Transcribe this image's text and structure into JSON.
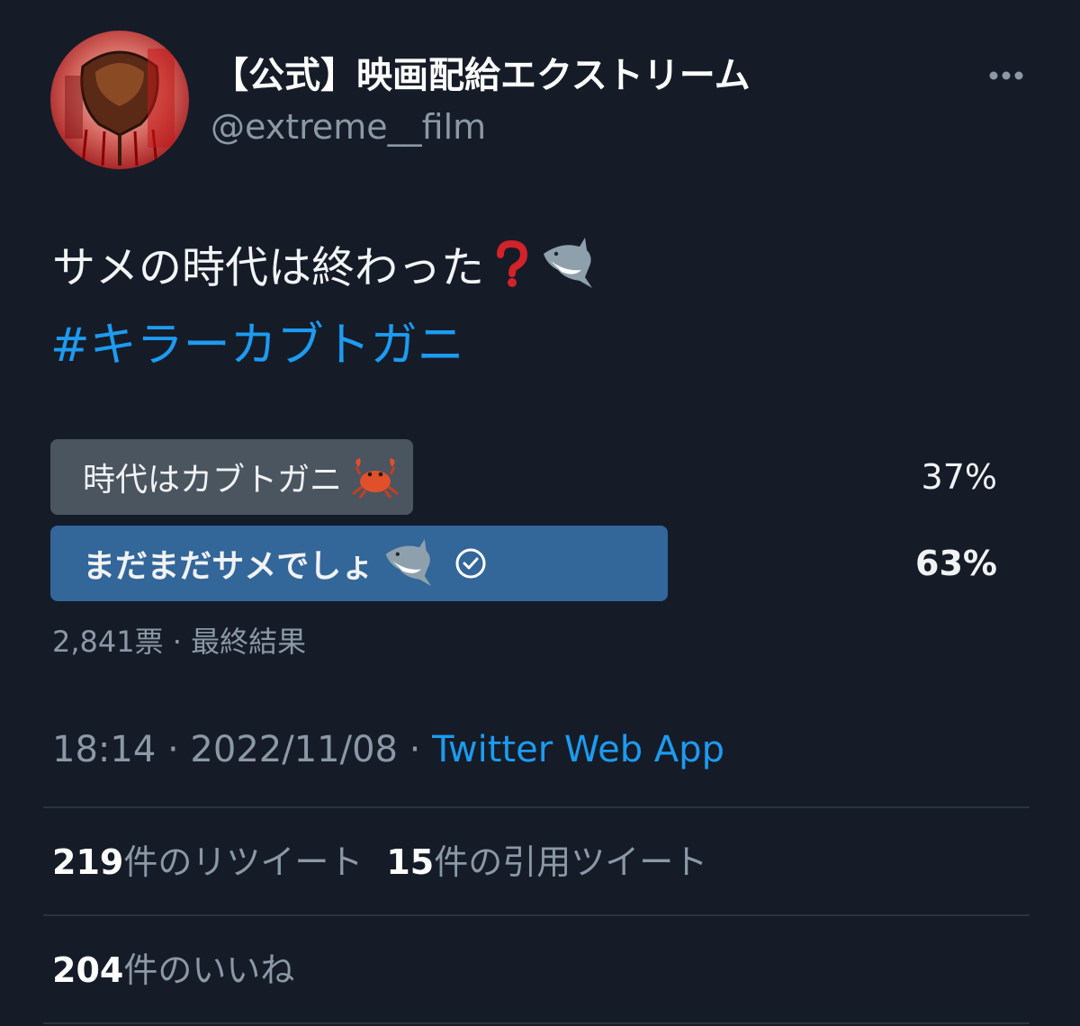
{
  "tweet": {
    "author": {
      "display_name": "【公式】映画配給エクストリーム",
      "handle": "@extreme__film"
    },
    "more_icon": "more-dots-icon",
    "text": "サメの時代は終わった",
    "text_icons": [
      "red-question-mark-icon",
      "shark-icon"
    ],
    "hashtag": "#キラーカブトガニ",
    "poll": {
      "options": [
        {
          "label": "時代はカブトガニ",
          "icon": "crab-icon",
          "percent_label": "37%",
          "percent": 37,
          "winner": false
        },
        {
          "label": "まだまだサメでしょ",
          "icon": "shark-icon",
          "percent_label": "63%",
          "percent": 63,
          "winner": true
        }
      ],
      "meta": "2,841票 · 最終結果"
    },
    "timestamp": "18:14 · 2022/11/08 · ",
    "source": "Twitter Web App",
    "stats": {
      "retweets_count": "219",
      "retweets_label": "件のリツイート",
      "quotes_count": "15",
      "quotes_label": "件の引用ツイート",
      "likes_count": "204",
      "likes_label": "件のいいね"
    },
    "colors": {
      "background": "#151c28",
      "link": "#1d9bf0",
      "poll_winner": "#336699",
      "poll_other": "#4a5560",
      "muted_text": "#8b98a5"
    }
  }
}
